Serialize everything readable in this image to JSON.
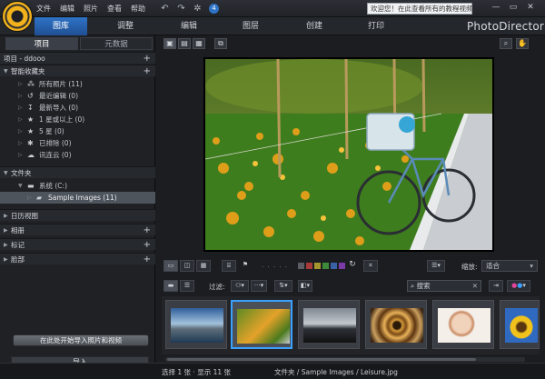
{
  "menu": {
    "file": "文件",
    "edit": "编辑",
    "photo": "照片",
    "view": "查看",
    "help": "帮助"
  },
  "notice": "欢迎您！在此查看所有的教程视频！",
  "modes": {
    "library": "图库",
    "adjust": "调整",
    "edit": "编辑",
    "layers": "图层",
    "create": "创建",
    "print": "打印"
  },
  "brand": "PhotoDirector",
  "left": {
    "tab_project": "项目",
    "tab_metadata": "元数据",
    "project_name": "项目 - ddooo",
    "smart_collections": "智能收藏夹",
    "items": [
      {
        "label": "所有照片 (11)"
      },
      {
        "label": "最近编辑 (0)"
      },
      {
        "label": "最新导入 (0)"
      },
      {
        "label": "1 星或以上 (0)"
      },
      {
        "label": "5 星 (0)"
      },
      {
        "label": "已排除 (0)"
      },
      {
        "label": "讯连云 (0)"
      }
    ],
    "folders": "文件夹",
    "system": "系统 (C:)",
    "sample_images": "Sample Images (11)",
    "calendar_view": "日历视图",
    "albums": "相册",
    "tags": "标记",
    "faces": "脸部",
    "import_area_label": "在此处开始导入照片和视频",
    "import_button": "导入"
  },
  "viewer": {
    "zoom_label": "缩放:",
    "zoom_value": "适合",
    "filter_label": "过滤:",
    "search_placeholder": "搜索"
  },
  "status": {
    "selection": "选择 1 张 · 显示 11 张",
    "path": "文件夹 / Sample Images / Leisure.jpg"
  },
  "colors": {
    "accent": "#2f73c6",
    "selection_border": "#3aa1ff"
  }
}
